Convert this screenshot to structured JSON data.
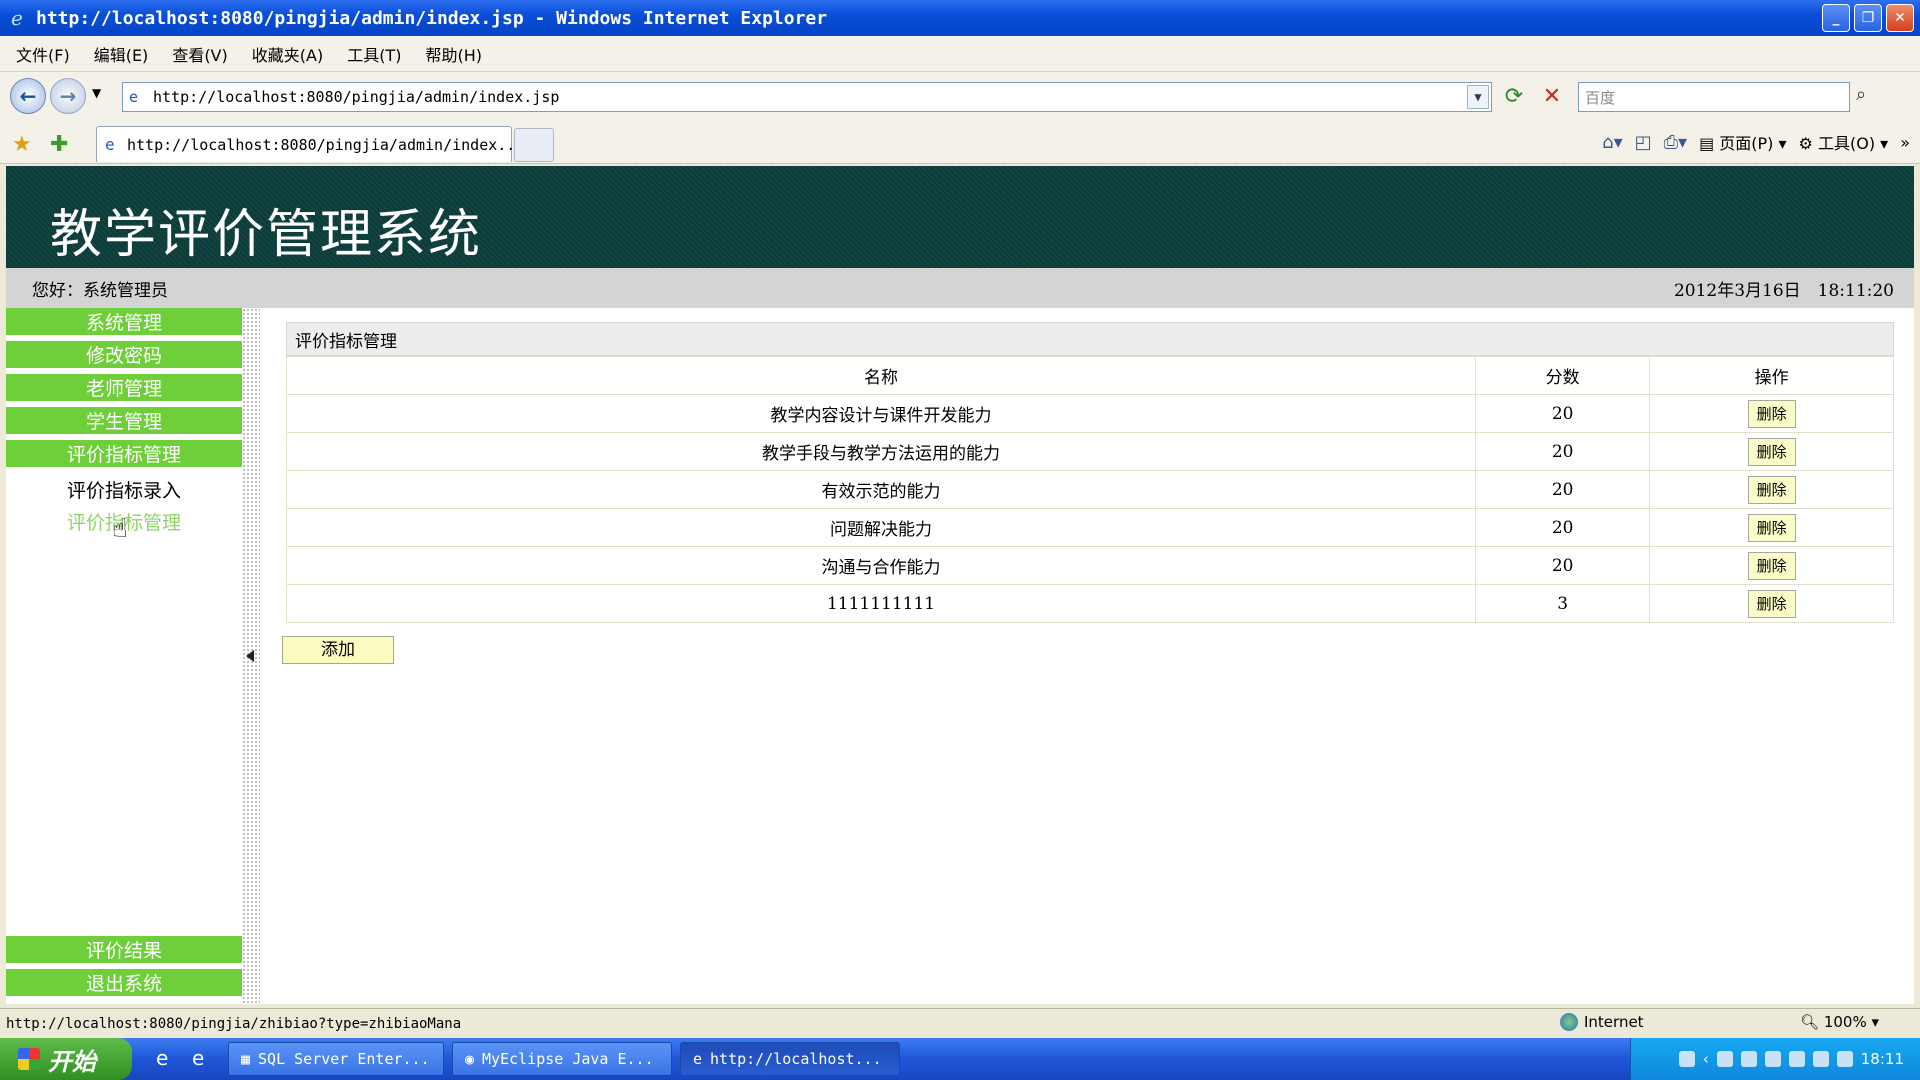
{
  "window": {
    "title": "http://localhost:8080/pingjia/admin/index.jsp - Windows Internet Explorer"
  },
  "menu": [
    "文件(F)",
    "编辑(E)",
    "查看(V)",
    "收藏夹(A)",
    "工具(T)",
    "帮助(H)"
  ],
  "address": {
    "url": "http://localhost:8080/pingjia/admin/index.jsp",
    "search_placeholder": "百度"
  },
  "tab": {
    "label": "http://localhost:8080/pingjia/admin/index..."
  },
  "command_bar": {
    "page": "页面(P)",
    "tools": "工具(O)"
  },
  "page": {
    "system_title": "教学评价管理系统",
    "greeting": "您好：系统管理员",
    "datetime": "2012年3月16日　18:11:20"
  },
  "sidebar": {
    "top_menus": [
      "系统管理",
      "修改密码",
      "老师管理",
      "学生管理",
      "评价指标管理"
    ],
    "sub_items": [
      "评价指标录入",
      "评价指标管理"
    ],
    "bottom_menus": [
      "评价结果",
      "退出系统"
    ]
  },
  "panel": {
    "title": "评价指标管理",
    "headers": [
      "名称",
      "分数",
      "操作"
    ],
    "delete_label": "删除",
    "rows": [
      {
        "name": "教学内容设计与课件开发能力",
        "score": "20"
      },
      {
        "name": "教学手段与教学方法运用的能力",
        "score": "20"
      },
      {
        "name": "有效示范的能力",
        "score": "20"
      },
      {
        "name": "问题解决能力",
        "score": "20"
      },
      {
        "name": "沟通与合作能力",
        "score": "20"
      },
      {
        "name": "1111111111",
        "score": "3"
      }
    ],
    "add_label": "添加"
  },
  "statusbar": {
    "url": "http://localhost:8080/pingjia/zhibiao?type=zhibiaoMana",
    "zone": "Internet",
    "zoom": "100%"
  },
  "taskbar": {
    "start": "开始",
    "tasks": [
      "SQL Server Enter...",
      "MyEclipse Java E...",
      "http://localhost..."
    ],
    "clock": "18:11"
  },
  "colors": {
    "menu_green": "#6ecf3a",
    "banner": "#0e3b38",
    "button_yellow": "#fbfbc8"
  }
}
